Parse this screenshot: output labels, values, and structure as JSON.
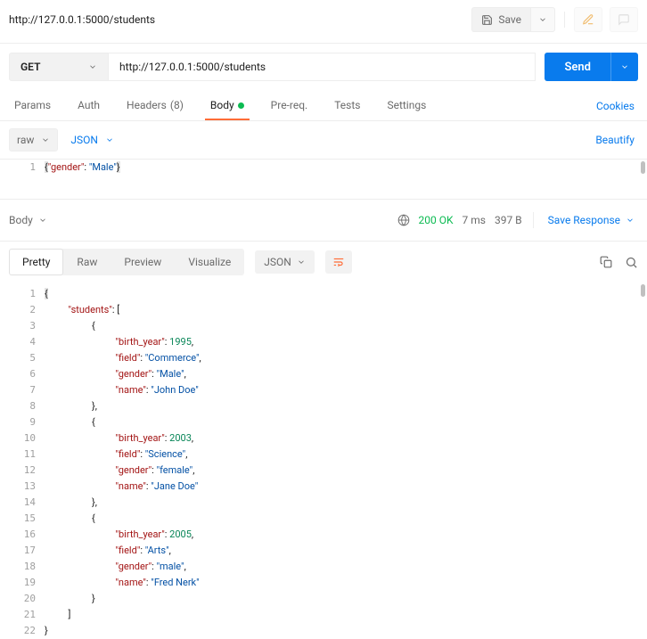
{
  "header": {
    "title": "http://127.0.0.1:5000/students",
    "save_label": "Save"
  },
  "request": {
    "method": "GET",
    "url": "http://127.0.0.1:5000/students",
    "send_label": "Send"
  },
  "tabs": {
    "params": "Params",
    "auth": "Auth",
    "headers": "Headers",
    "headers_count": "(8)",
    "body": "Body",
    "prereq": "Pre-req.",
    "tests": "Tests",
    "settings": "Settings",
    "cookies": "Cookies"
  },
  "body_toolbar": {
    "mode": "raw",
    "format": "JSON",
    "beautify": "Beautify"
  },
  "request_body": {
    "line": "1"
  },
  "response": {
    "section_label": "Body",
    "status": "200 OK",
    "time": "7 ms",
    "size": "397 B",
    "save_response": "Save Response",
    "view_tabs": {
      "pretty": "Pretty",
      "raw": "Raw",
      "preview": "Preview",
      "visualize": "Visualize",
      "format": "JSON"
    }
  },
  "chart_data": {
    "type": "table",
    "title": "Response JSON body",
    "data": {
      "students": [
        {
          "birth_year": 1995,
          "field": "Commerce",
          "gender": "Male",
          "name": "John Doe"
        },
        {
          "birth_year": 2003,
          "field": "Science",
          "gender": "female",
          "name": "Jane Doe"
        },
        {
          "birth_year": 2005,
          "field": "Arts",
          "gender": "male",
          "name": "Fred Nerk"
        }
      ]
    },
    "request_body": {
      "gender": "Male"
    }
  }
}
